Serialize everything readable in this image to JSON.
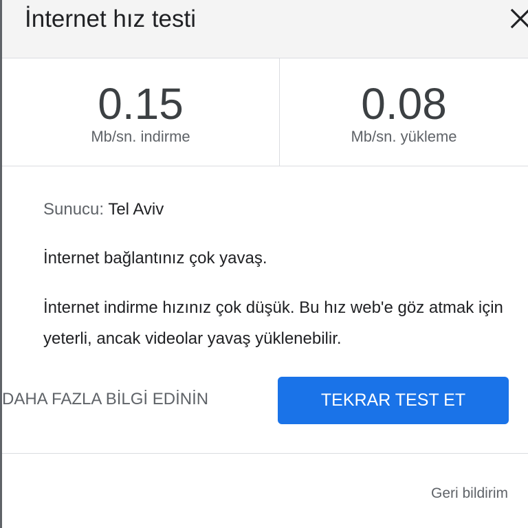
{
  "header": {
    "title": "İnternet hız testi",
    "close_icon": "close-icon"
  },
  "metrics": {
    "download": {
      "value": "0.15",
      "unit_label": "Mb/sn. indirme"
    },
    "upload": {
      "value": "0.08",
      "unit_label": "Mb/sn. yükleme"
    }
  },
  "server": {
    "label": "Sunucu:",
    "value": "Tel Aviv"
  },
  "messages": {
    "status": "İnternet bağlantınız çok yavaş.",
    "detail": "İnternet indirme hızınız çok düşük. Bu hız web'e göz atmak için yeterli, ancak videolar yavaş yüklenebilir."
  },
  "actions": {
    "more_info_label": "DAHA FAZLA BİLGİ EDİNİN",
    "retest_label": "TEKRAR TEST ET"
  },
  "footer": {
    "feedback_label": "Geri bildirim"
  },
  "colors": {
    "primary_button": "#1a73e8",
    "header_background": "#f4f4f4",
    "divider": "#dadce0"
  }
}
